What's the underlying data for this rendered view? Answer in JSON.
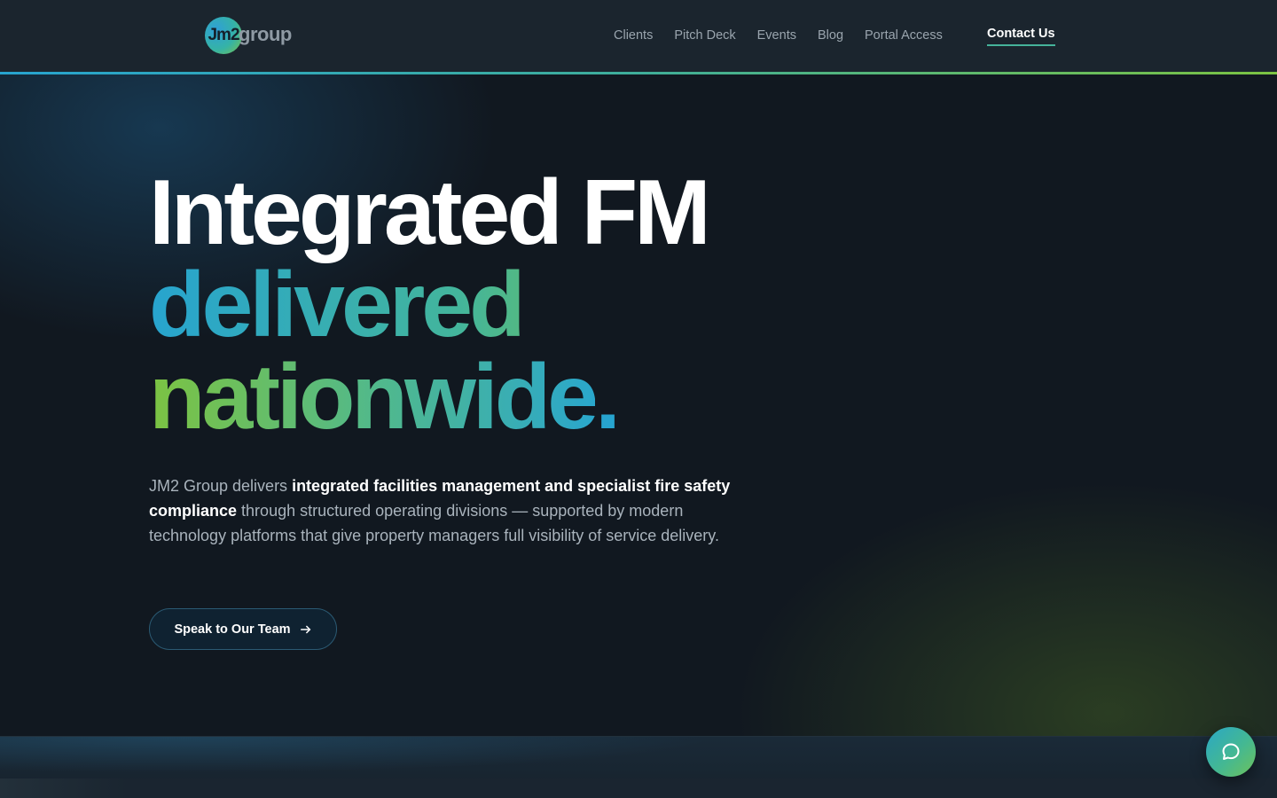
{
  "header": {
    "logo": {
      "mark_text": "Jm2",
      "wordmark": "group"
    },
    "nav": [
      {
        "label": "Clients"
      },
      {
        "label": "Pitch Deck"
      },
      {
        "label": "Events"
      },
      {
        "label": "Blog"
      },
      {
        "label": "Portal Access"
      }
    ],
    "contact_label": "Contact Us"
  },
  "hero": {
    "title_line1": "Integrated FM",
    "title_line2": "delivered",
    "title_line3": "nationwide",
    "title_period": ".",
    "description": {
      "part1": "JM2 Group delivers ",
      "bold1": "integrated facilities management and specialist fire safety compliance",
      "part2": " through structured operating divisions — supported by modern technology platforms that give property managers full visibility of service delivery."
    },
    "cta_label": "Speak to Our Team",
    "cta_icon": "arrow-right-icon"
  },
  "chat": {
    "icon": "chat-bubble-icon"
  },
  "colors": {
    "accent_blue": "#27a4cf",
    "accent_teal": "#43b59c",
    "accent_green": "#7cc342",
    "background": "#111820",
    "header_bg": "#1b252e"
  }
}
